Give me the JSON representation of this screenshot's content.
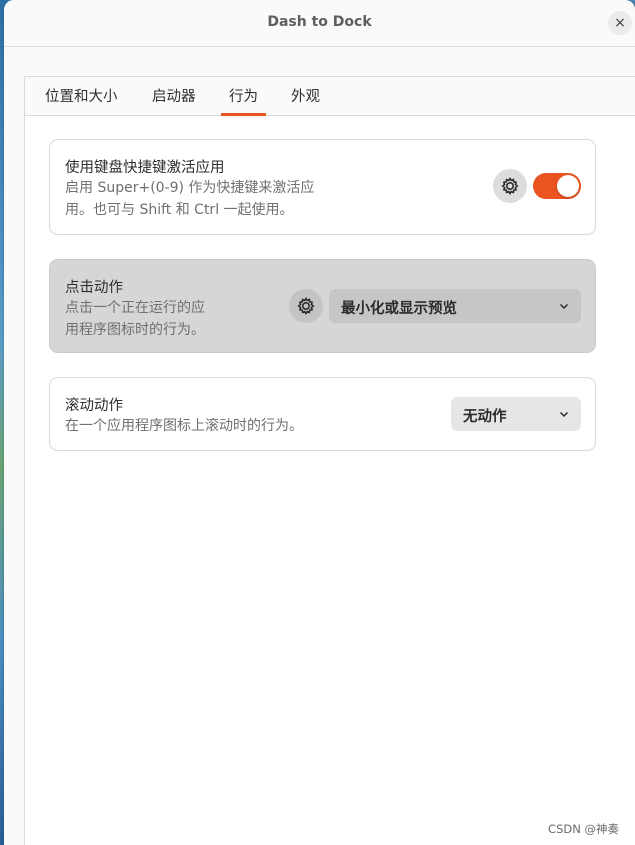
{
  "window": {
    "title": "Dash to Dock",
    "close_symbol": "×"
  },
  "tabs": [
    {
      "label": "位置和大小",
      "active": false
    },
    {
      "label": "启动器",
      "active": false
    },
    {
      "label": "行为",
      "active": true
    },
    {
      "label": "外观",
      "active": false
    }
  ],
  "settings": {
    "hotkeys": {
      "title": "使用键盘快捷键激活应用",
      "subtitle": "启用 Super+(0-9) 作为快捷键来激活应\n用。也可与 Shift 和 Ctrl 一起使用。",
      "toggle_on": true,
      "gear_icon": "gear-icon"
    },
    "click_action": {
      "title": "点击动作",
      "subtitle": "点击一个正在运行的应\n用程序图标时的行为。",
      "selected": "最小化或显示预览",
      "gear_icon": "gear-icon"
    },
    "scroll_action": {
      "title": "滚动动作",
      "subtitle": "在一个应用程序图标上滚动时的行为。",
      "selected": "无动作"
    }
  },
  "colors": {
    "accent": "#e95420"
  },
  "watermark": "CSDN @神奏"
}
